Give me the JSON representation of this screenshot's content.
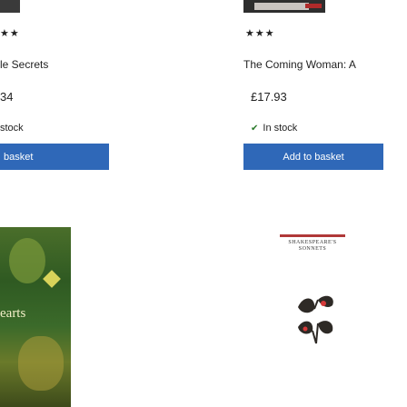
{
  "products": [
    {
      "stars": "★★",
      "title": "le Secrets",
      "price": "34",
      "stock_text": "stock",
      "button_label": "basket",
      "cover_text": "earts"
    },
    {
      "stars": "★★★",
      "title": "The Coming Woman: A",
      "price": "£17.93",
      "stock_text": "In stock",
      "button_label": "Add to basket",
      "cover_title": "SHAKESPEARE'S SONNETS"
    }
  ],
  "colors": {
    "button_bg": "#2f68b8",
    "button_text": "#ffffff",
    "stock_tick": "#2a7a2a"
  }
}
